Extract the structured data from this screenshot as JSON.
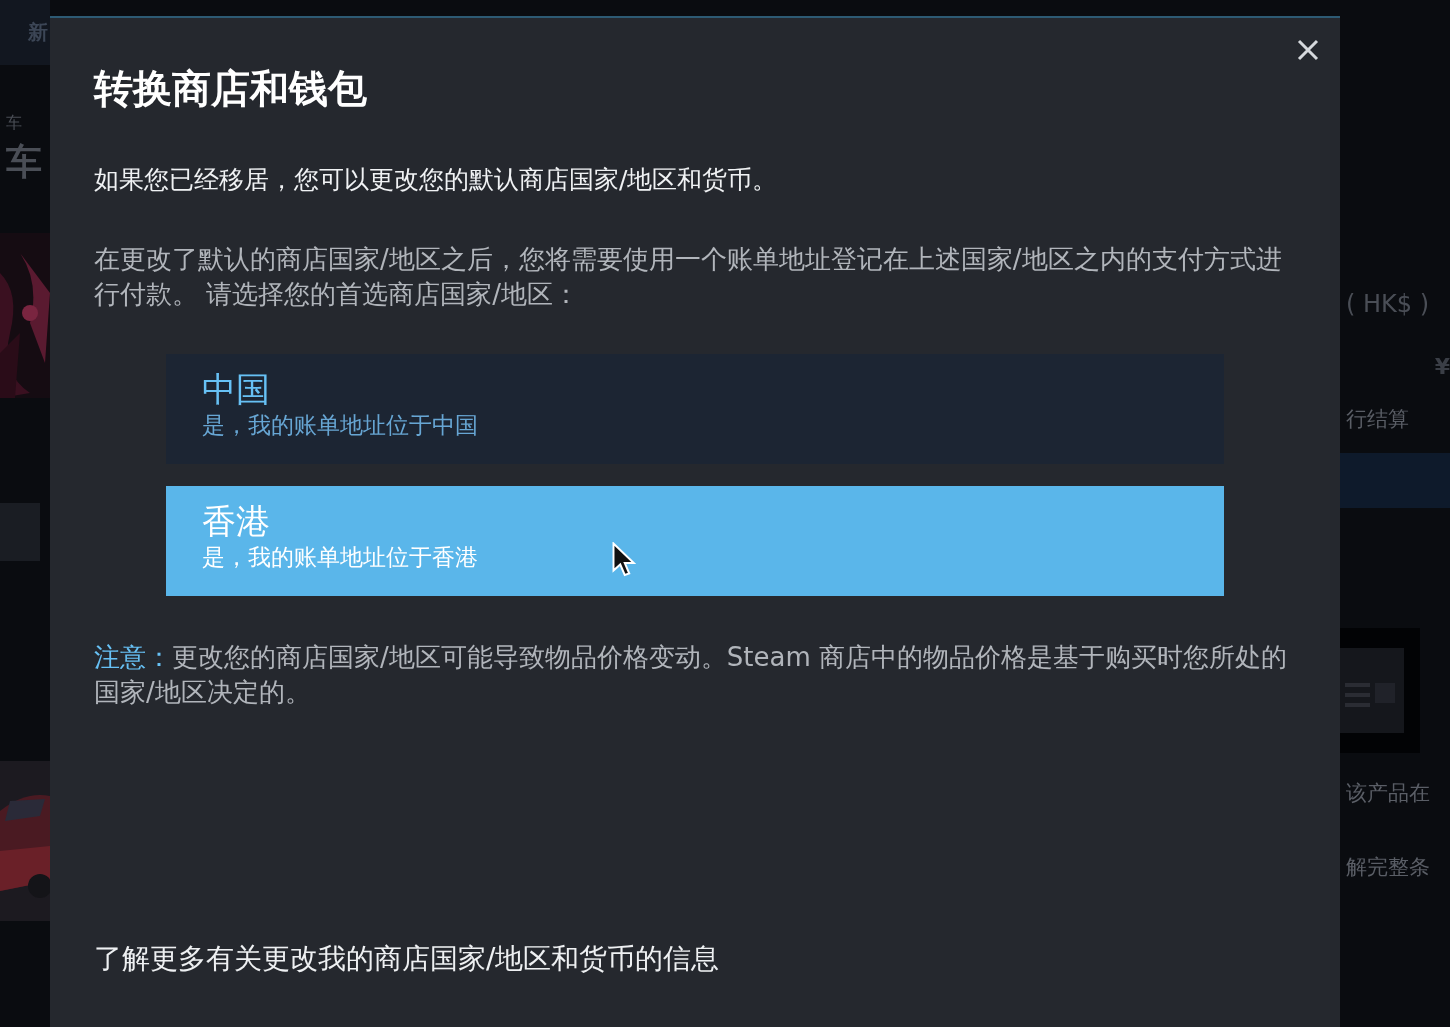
{
  "background": {
    "left_texts": [
      {
        "kind": "nav",
        "text": "新"
      },
      {
        "kind": "small",
        "text": "车"
      },
      {
        "kind": "heading",
        "text": "车"
      }
    ],
    "right_texts": [
      {
        "kind": "currency",
        "text": "( HK$ )"
      },
      {
        "kind": "price",
        "text": "¥"
      },
      {
        "kind": "text",
        "text": "行结算"
      },
      {
        "kind": "button"
      },
      {
        "kind": "thumb"
      },
      {
        "kind": "text",
        "text": "该产品在"
      },
      {
        "kind": "text",
        "text": "解完整条"
      }
    ]
  },
  "dialog": {
    "title": "转换商店和钱包",
    "intro": "如果您已经移居，您可以更改您的默认商店国家/地区和货币。",
    "description": "在更改了默认的商店国家/地区之后，您将需要使用一个账单地址登记在上述国家/地区之内的支付方式进行付款。 请选择您的首选商店国家/地区：",
    "options": [
      {
        "name": "中国",
        "subtitle": "是，我的账单地址位于中国",
        "selected": false
      },
      {
        "name": "香港",
        "subtitle": "是，我的账单地址位于香港",
        "selected": true
      }
    ],
    "note": {
      "label": "注意：",
      "text": "更改您的商店国家/地区可能导致物品价格变动。Steam 商店中的物品价格是基于购买时您所处的国家/地区决定的。"
    },
    "link": "了解更多有关更改我的商店国家/地区和货币的信息"
  }
}
